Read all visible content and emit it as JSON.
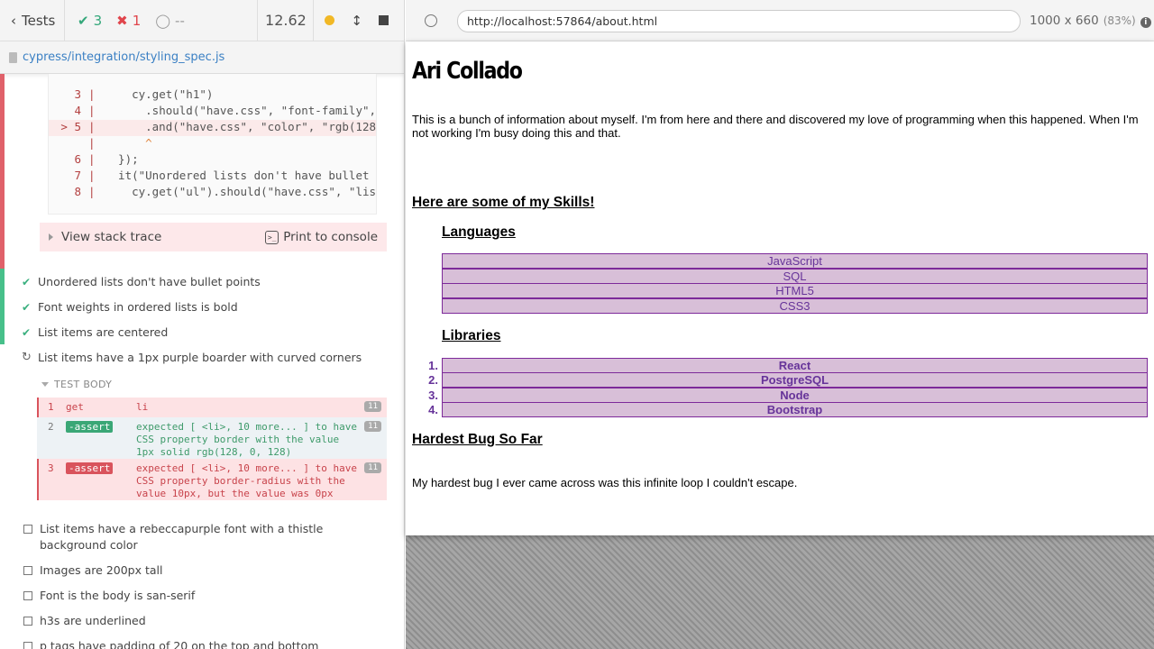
{
  "header": {
    "tests_label": "Tests",
    "passed": "3",
    "failed": "1",
    "pending": "--",
    "duration": "12.62"
  },
  "spec": {
    "path": "cypress/integration/styling_spec.js"
  },
  "code_frame": {
    "lines": [
      {
        "num": "3",
        "gutter": "|",
        "code": "    cy.get(\"h1\")"
      },
      {
        "num": "4",
        "gutter": "|",
        "code": "      .should(\"have.css\", \"font-family\","
      },
      {
        "num": "> 5",
        "gutter": "|",
        "code": "      .and(\"have.css\", \"color\", \"rgb(128"
      },
      {
        "num": "",
        "gutter": "|",
        "code": "      ^"
      },
      {
        "num": "6",
        "gutter": "|",
        "code": "  });"
      },
      {
        "num": "7",
        "gutter": "|",
        "code": "  it(\"Unordered lists don't have bullet"
      },
      {
        "num": "8",
        "gutter": "|",
        "code": "    cy.get(\"ul\").should(\"have.css\", \"lis"
      }
    ]
  },
  "stack": {
    "view_label": "View stack trace",
    "print_label": "Print to console",
    "term_glyph": ">_"
  },
  "tests_passed": [
    "Unordered lists don't have bullet points",
    "Font weights in ordered lists is bold",
    "List items are centered"
  ],
  "test_running": "List items have a 1px purple boarder with curved corners",
  "test_body_label": "TEST BODY",
  "commands": [
    {
      "num": "1",
      "name": "get",
      "msg": "li",
      "count": "11",
      "state": "err"
    },
    {
      "num": "2",
      "name": "-assert",
      "msg": "expected [ <li>, 10 more... ] to have CSS property border with the value 1px solid rgb(128, 0, 128)",
      "count": "11",
      "state": "ok"
    },
    {
      "num": "3",
      "name": "-assert",
      "msg": "expected [ <li>, 10 more... ] to have CSS property border-radius with the value 10px, but the value was 0px",
      "count": "11",
      "state": "err"
    }
  ],
  "tests_pending": [
    "List items have a rebeccapurple font with a thistle background color",
    "Images are 200px tall",
    "Font is the body is san-serif",
    "h3s are underlined",
    "p tags have padding of 20 on the top and bottom"
  ],
  "aut_header": {
    "url": "http://localhost:57864/about.html",
    "viewport": "1000 x 660",
    "scale": "(83%)",
    "info_glyph": "i"
  },
  "aut_page": {
    "name": "Ari Collado",
    "intro": "This is a bunch of information about myself. I'm from here and there and discovered my love of programming when this happened. When I'm not working I'm busy doing this and that.",
    "skills_heading": "Here are some of my Skills!",
    "languages_heading": "Languages",
    "languages": [
      "JavaScript",
      "SQL",
      "HTML5",
      "CSS3"
    ],
    "libraries_heading": "Libraries",
    "libraries": [
      "React",
      "PostgreSQL",
      "Node",
      "Bootstrap"
    ],
    "library_nums": [
      "1.",
      "2.",
      "3.",
      "4."
    ],
    "bug_heading": "Hardest Bug So Far",
    "bug_text": "My hardest bug I ever came across was this infinite loop I couldn't escape."
  },
  "colors": {
    "pass": "#34a77a",
    "fail": "#e0454c",
    "link": "#3b80c4",
    "thistle": "#d8bfd8",
    "rebeccapurple": "#663399"
  }
}
